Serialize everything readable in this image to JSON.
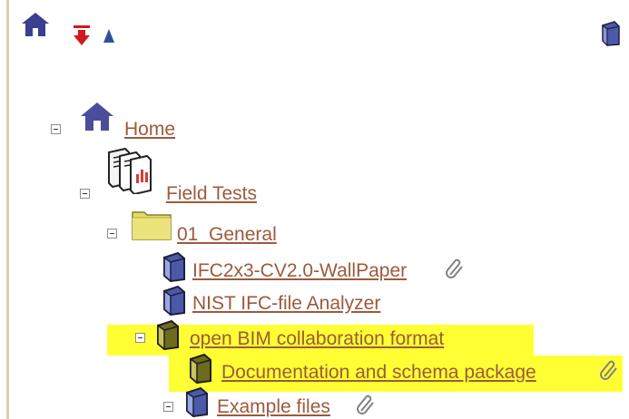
{
  "toolbar": {
    "icons": [
      "home-icon",
      "move-down-icon",
      "move-up-icon",
      "book-icon"
    ]
  },
  "tree": {
    "home": {
      "label": "Home"
    },
    "field_tests": {
      "label": "Field Tests"
    },
    "general": {
      "label": "01_General"
    },
    "wallpaper": {
      "label": "IFC2x3-CV2.0-WallPaper"
    },
    "nist": {
      "label": "NIST IFC-file Analyzer"
    },
    "bcf": {
      "label": "open BIM collaboration format"
    },
    "docs": {
      "label": "Documentation and schema package"
    },
    "examples": {
      "label": "Example files"
    }
  },
  "colors": {
    "link": "#9c5a3c",
    "highlight": "#ffff33",
    "border": "#d8d2b4",
    "folder_yellow": "#e6dc6a",
    "book_blue": "#4b5aa8"
  }
}
